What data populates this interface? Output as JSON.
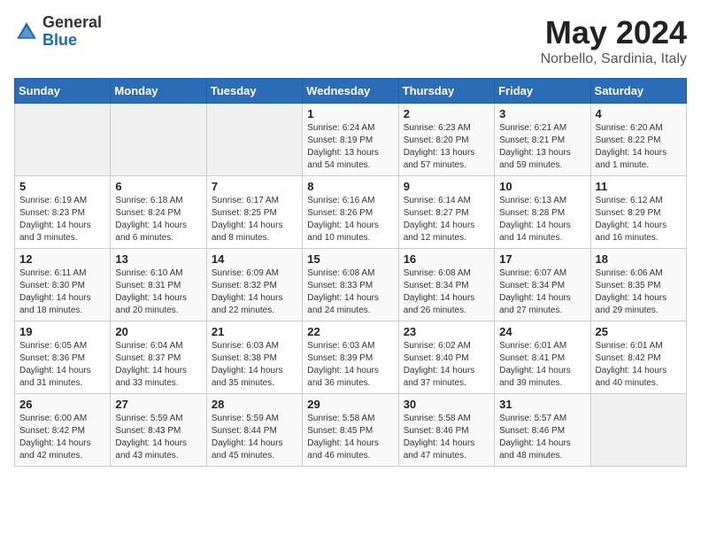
{
  "header": {
    "logo_general": "General",
    "logo_blue": "Blue",
    "title_month": "May 2024",
    "title_location": "Norbello, Sardinia, Italy"
  },
  "calendar": {
    "days_of_week": [
      "Sunday",
      "Monday",
      "Tuesday",
      "Wednesday",
      "Thursday",
      "Friday",
      "Saturday"
    ],
    "weeks": [
      [
        {
          "day": "",
          "info": ""
        },
        {
          "day": "",
          "info": ""
        },
        {
          "day": "",
          "info": ""
        },
        {
          "day": "1",
          "info": "Sunrise: 6:24 AM\nSunset: 8:19 PM\nDaylight: 13 hours\nand 54 minutes."
        },
        {
          "day": "2",
          "info": "Sunrise: 6:23 AM\nSunset: 8:20 PM\nDaylight: 13 hours\nand 57 minutes."
        },
        {
          "day": "3",
          "info": "Sunrise: 6:21 AM\nSunset: 8:21 PM\nDaylight: 13 hours\nand 59 minutes."
        },
        {
          "day": "4",
          "info": "Sunrise: 6:20 AM\nSunset: 8:22 PM\nDaylight: 14 hours\nand 1 minute."
        }
      ],
      [
        {
          "day": "5",
          "info": "Sunrise: 6:19 AM\nSunset: 8:23 PM\nDaylight: 14 hours\nand 3 minutes."
        },
        {
          "day": "6",
          "info": "Sunrise: 6:18 AM\nSunset: 8:24 PM\nDaylight: 14 hours\nand 6 minutes."
        },
        {
          "day": "7",
          "info": "Sunrise: 6:17 AM\nSunset: 8:25 PM\nDaylight: 14 hours\nand 8 minutes."
        },
        {
          "day": "8",
          "info": "Sunrise: 6:16 AM\nSunset: 8:26 PM\nDaylight: 14 hours\nand 10 minutes."
        },
        {
          "day": "9",
          "info": "Sunrise: 6:14 AM\nSunset: 8:27 PM\nDaylight: 14 hours\nand 12 minutes."
        },
        {
          "day": "10",
          "info": "Sunrise: 6:13 AM\nSunset: 8:28 PM\nDaylight: 14 hours\nand 14 minutes."
        },
        {
          "day": "11",
          "info": "Sunrise: 6:12 AM\nSunset: 8:29 PM\nDaylight: 14 hours\nand 16 minutes."
        }
      ],
      [
        {
          "day": "12",
          "info": "Sunrise: 6:11 AM\nSunset: 8:30 PM\nDaylight: 14 hours\nand 18 minutes."
        },
        {
          "day": "13",
          "info": "Sunrise: 6:10 AM\nSunset: 8:31 PM\nDaylight: 14 hours\nand 20 minutes."
        },
        {
          "day": "14",
          "info": "Sunrise: 6:09 AM\nSunset: 8:32 PM\nDaylight: 14 hours\nand 22 minutes."
        },
        {
          "day": "15",
          "info": "Sunrise: 6:08 AM\nSunset: 8:33 PM\nDaylight: 14 hours\nand 24 minutes."
        },
        {
          "day": "16",
          "info": "Sunrise: 6:08 AM\nSunset: 8:34 PM\nDaylight: 14 hours\nand 26 minutes."
        },
        {
          "day": "17",
          "info": "Sunrise: 6:07 AM\nSunset: 8:34 PM\nDaylight: 14 hours\nand 27 minutes."
        },
        {
          "day": "18",
          "info": "Sunrise: 6:06 AM\nSunset: 8:35 PM\nDaylight: 14 hours\nand 29 minutes."
        }
      ],
      [
        {
          "day": "19",
          "info": "Sunrise: 6:05 AM\nSunset: 8:36 PM\nDaylight: 14 hours\nand 31 minutes."
        },
        {
          "day": "20",
          "info": "Sunrise: 6:04 AM\nSunset: 8:37 PM\nDaylight: 14 hours\nand 33 minutes."
        },
        {
          "day": "21",
          "info": "Sunrise: 6:03 AM\nSunset: 8:38 PM\nDaylight: 14 hours\nand 35 minutes."
        },
        {
          "day": "22",
          "info": "Sunrise: 6:03 AM\nSunset: 8:39 PM\nDaylight: 14 hours\nand 36 minutes."
        },
        {
          "day": "23",
          "info": "Sunrise: 6:02 AM\nSunset: 8:40 PM\nDaylight: 14 hours\nand 37 minutes."
        },
        {
          "day": "24",
          "info": "Sunrise: 6:01 AM\nSunset: 8:41 PM\nDaylight: 14 hours\nand 39 minutes."
        },
        {
          "day": "25",
          "info": "Sunrise: 6:01 AM\nSunset: 8:42 PM\nDaylight: 14 hours\nand 40 minutes."
        }
      ],
      [
        {
          "day": "26",
          "info": "Sunrise: 6:00 AM\nSunset: 8:42 PM\nDaylight: 14 hours\nand 42 minutes."
        },
        {
          "day": "27",
          "info": "Sunrise: 5:59 AM\nSunset: 8:43 PM\nDaylight: 14 hours\nand 43 minutes."
        },
        {
          "day": "28",
          "info": "Sunrise: 5:59 AM\nSunset: 8:44 PM\nDaylight: 14 hours\nand 45 minutes."
        },
        {
          "day": "29",
          "info": "Sunrise: 5:58 AM\nSunset: 8:45 PM\nDaylight: 14 hours\nand 46 minutes."
        },
        {
          "day": "30",
          "info": "Sunrise: 5:58 AM\nSunset: 8:46 PM\nDaylight: 14 hours\nand 47 minutes."
        },
        {
          "day": "31",
          "info": "Sunrise: 5:57 AM\nSunset: 8:46 PM\nDaylight: 14 hours\nand 48 minutes."
        },
        {
          "day": "",
          "info": ""
        }
      ]
    ]
  }
}
